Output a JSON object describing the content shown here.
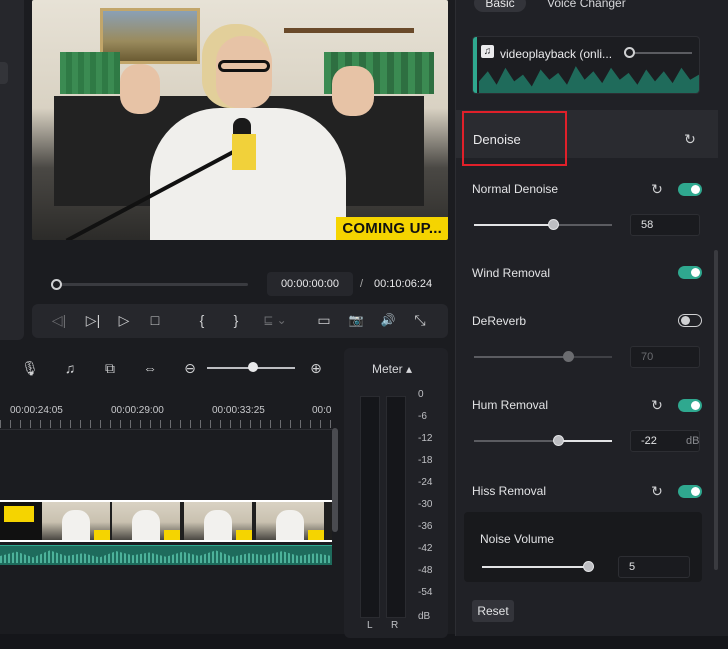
{
  "player": {
    "overlay_text": "COMING UP...",
    "timecode_current": "00:00:00:00",
    "timecode_separator": "/",
    "timecode_total": "00:10:06:24",
    "controls": {
      "prev_frame": "◁|",
      "play_backward": "▷|",
      "play": "▷",
      "stop": "□",
      "mark_in": "{",
      "mark_out": "}",
      "snapshot_icon": "📷",
      "volume_icon": "🔊",
      "fullscreen_icon": "⤡"
    }
  },
  "timeline": {
    "ruler": [
      "00:00:24:05",
      "00:00:29:00",
      "00:00:33:25",
      "00:0"
    ],
    "tools": {
      "mic_icon": "🎙",
      "music_icon": "♫",
      "zoom_out": "⊖",
      "zoom_in": "⊕"
    }
  },
  "meter": {
    "title": "Meter ▴",
    "db_labels": [
      "0",
      "-6",
      "-12",
      "-18",
      "-24",
      "-30",
      "-36",
      "-42",
      "-48",
      "-54",
      "dB"
    ],
    "left": "L",
    "right": "R"
  },
  "audio_panel": {
    "tabs": {
      "basic": "Basic",
      "voice_changer": "Voice Changer"
    },
    "clip_name": "videoplayback (onli...",
    "denoise": {
      "title": "Denoise",
      "normal_denoise": {
        "label": "Normal Denoise",
        "value": "58",
        "enabled": true,
        "level": 0.58
      },
      "wind_removal": {
        "label": "Wind Removal",
        "enabled": true
      },
      "dereverb": {
        "label": "DeReverb",
        "value": "70",
        "enabled": false,
        "level": 0.7
      },
      "hum_removal": {
        "label": "Hum Removal",
        "value": "-22",
        "unit": "dB",
        "enabled": true
      },
      "hiss_removal": {
        "label": "Hiss Removal",
        "enabled": true
      },
      "noise_volume": {
        "label": "Noise Volume",
        "value": "5"
      }
    },
    "reset": "Reset"
  },
  "colors": {
    "accent": "#2fa88f",
    "highlight": "#e0202a",
    "overlay_yellow": "#f5d400"
  }
}
